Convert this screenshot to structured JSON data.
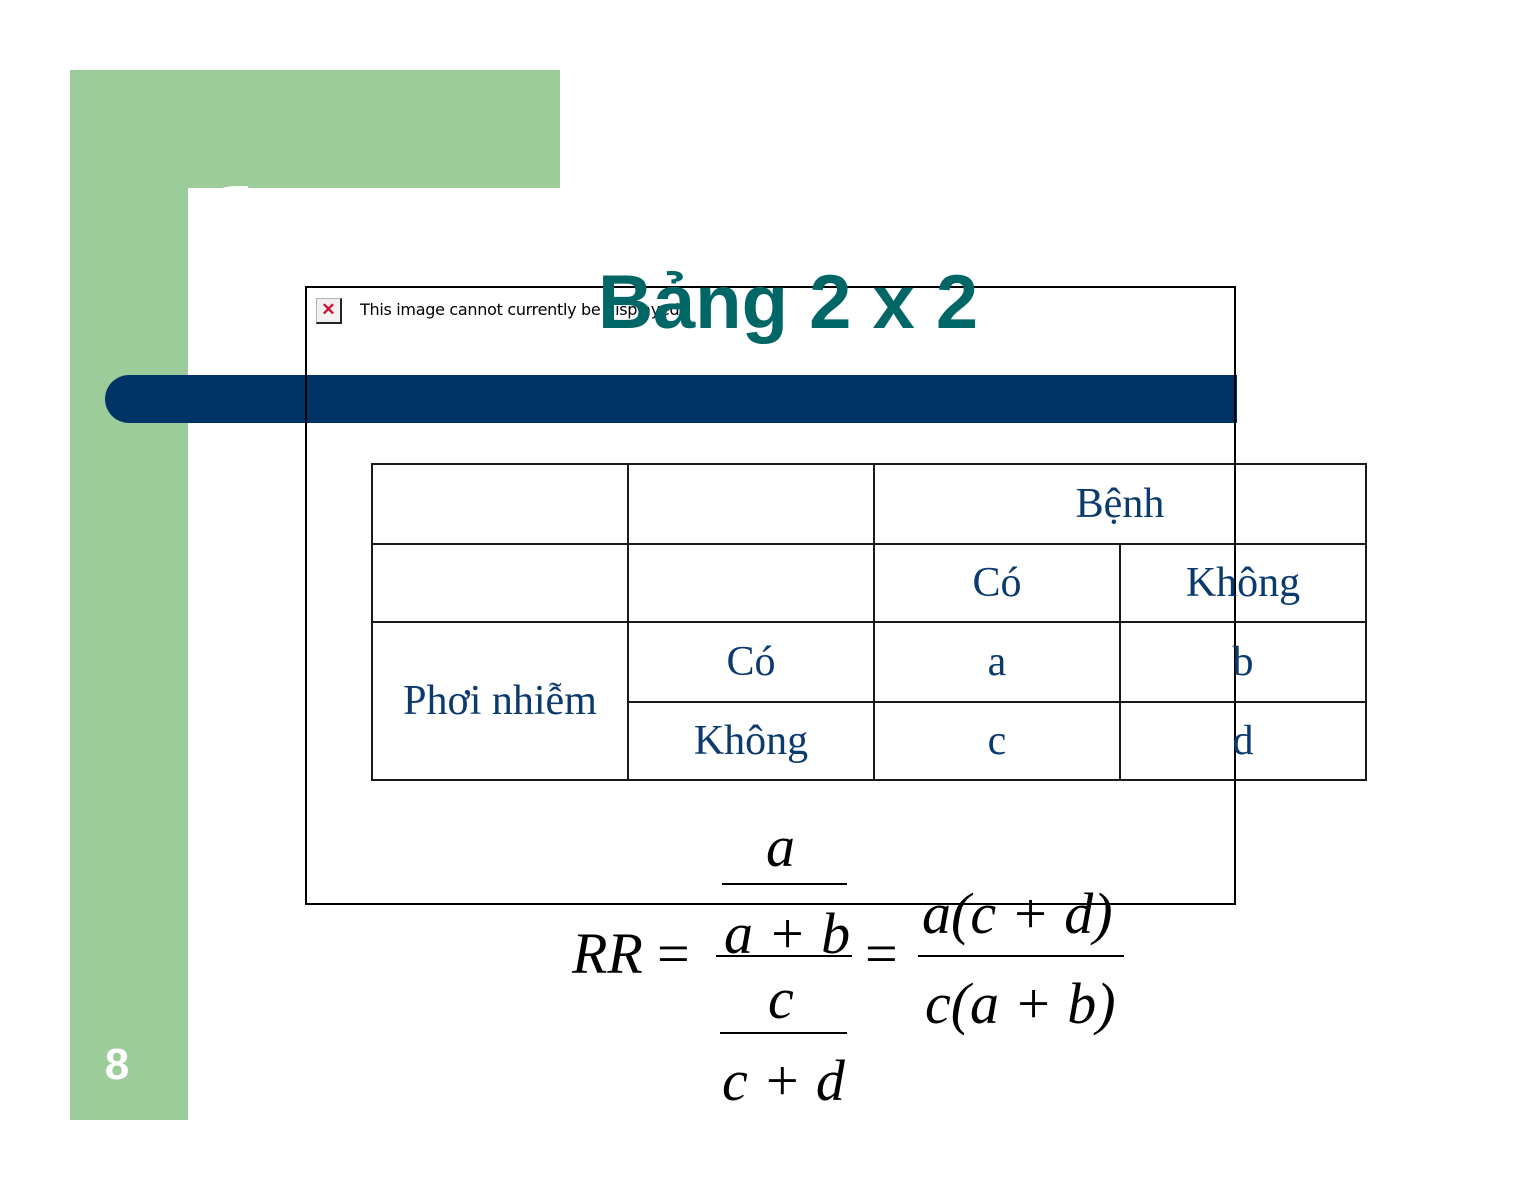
{
  "slide": {
    "number": "8",
    "title": "Bảng 2 x 2",
    "broken_image": {
      "icon": "broken-image-icon",
      "message": "This image cannot currently be displayed."
    },
    "colors": {
      "accent_green": "#9bcc9a",
      "bar_blue": "#003366",
      "title_teal": "#006666",
      "table_text": "#0b3a6e"
    }
  },
  "table": {
    "header_group": "Bệnh",
    "disease_columns": [
      "Có",
      "Không"
    ],
    "row_group": "Phơi nhiễm",
    "exposure_rows": [
      {
        "label": "Có",
        "cells": [
          "a",
          "b"
        ]
      },
      {
        "label": "Không",
        "cells": [
          "c",
          "d"
        ]
      }
    ]
  },
  "formula": {
    "lhs": "RR",
    "eq1": "=",
    "upper_num": "a",
    "upper_den": "a + b",
    "lower_num": "c",
    "lower_den": "c + d",
    "eq2": "=",
    "result_num": "a(c + d)",
    "result_den": "c(a + b)"
  }
}
